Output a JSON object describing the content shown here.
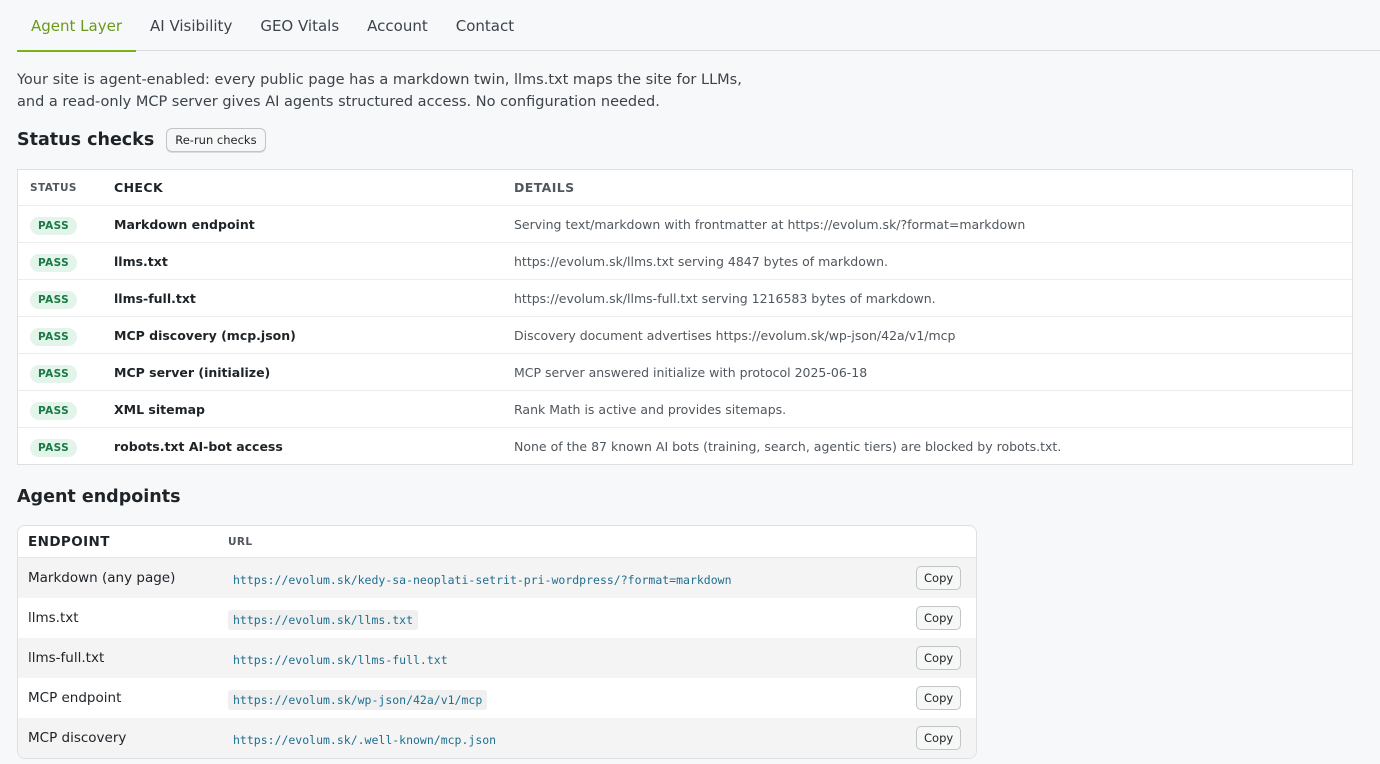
{
  "tabs": [
    "Agent Layer",
    "AI Visibility",
    "GEO Vitals",
    "Account",
    "Contact"
  ],
  "intro": "Your site is agent-enabled: every public page has a markdown twin, llms.txt maps the site for LLMs, and a read-only MCP server gives AI agents structured access. No configuration needed.",
  "status": {
    "title": "Status checks",
    "rerun_label": "Re-run checks",
    "headers": [
      "STATUS",
      "CHECK",
      "DETAILS"
    ],
    "rows": [
      {
        "status": "PASS",
        "check": "Markdown endpoint",
        "details": "Serving text/markdown with frontmatter at https://evolum.sk/?format=markdown"
      },
      {
        "status": "PASS",
        "check": "llms.txt",
        "details": "https://evolum.sk/llms.txt serving 4847 bytes of markdown."
      },
      {
        "status": "PASS",
        "check": "llms-full.txt",
        "details": "https://evolum.sk/llms-full.txt serving 1216583 bytes of markdown."
      },
      {
        "status": "PASS",
        "check": "MCP discovery (mcp.json)",
        "details": "Discovery document advertises https://evolum.sk/wp-json/42a/v1/mcp"
      },
      {
        "status": "PASS",
        "check": "MCP server (initialize)",
        "details": "MCP server answered initialize with protocol 2025-06-18"
      },
      {
        "status": "PASS",
        "check": "XML sitemap",
        "details": "Rank Math is active and provides sitemaps."
      },
      {
        "status": "PASS",
        "check": "robots.txt AI-bot access",
        "details": "None of the 87 known AI bots (training, search, agentic tiers) are blocked by robots.txt."
      }
    ]
  },
  "endpoints": {
    "title": "Agent endpoints",
    "headers": [
      "ENDPOINT",
      "URL"
    ],
    "copy_label": "Copy",
    "rows": [
      {
        "name": "Markdown (any page)",
        "url": "https://evolum.sk/kedy-sa-neoplati-setrit-pri-wordpress/?format=markdown"
      },
      {
        "name": "llms.txt",
        "url": "https://evolum.sk/llms.txt"
      },
      {
        "name": "llms-full.txt",
        "url": "https://evolum.sk/llms-full.txt"
      },
      {
        "name": "MCP endpoint",
        "url": "https://evolum.sk/wp-json/42a/v1/mcp"
      },
      {
        "name": "MCP discovery",
        "url": "https://evolum.sk/.well-known/mcp.json"
      }
    ]
  }
}
